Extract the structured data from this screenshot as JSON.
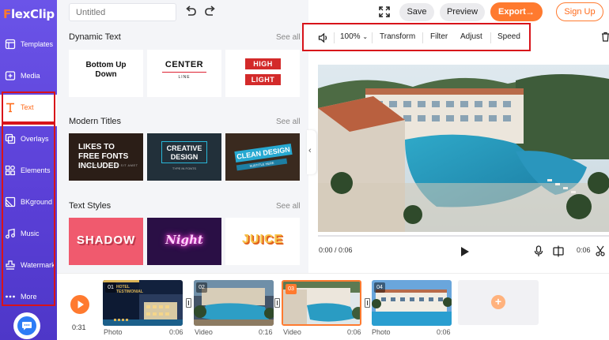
{
  "app": {
    "logo_mark": "F",
    "logo_rest": "lexClip",
    "title_placeholder": "Untitled"
  },
  "header": {
    "save_label": "Save",
    "preview_label": "Preview",
    "export_label": "Export",
    "export_arrow": "→",
    "signup_label": "Sign Up"
  },
  "sidebar": {
    "items": [
      {
        "label": "Templates",
        "icon": "templates-icon"
      },
      {
        "label": "Media",
        "icon": "media-icon"
      },
      {
        "label": "Text",
        "icon": "text-icon",
        "active": true
      },
      {
        "label": "Overlays",
        "icon": "overlays-icon"
      },
      {
        "label": "Elements",
        "icon": "elements-icon"
      },
      {
        "label": "BKground",
        "icon": "background-icon"
      },
      {
        "label": "Music",
        "icon": "music-icon"
      },
      {
        "label": "Watermark",
        "icon": "watermark-icon"
      },
      {
        "label": "More",
        "icon": "more-icon"
      }
    ]
  },
  "panel": {
    "see_all": "See all",
    "sections": [
      {
        "title": "Dynamic Text",
        "cards": {
          "c1": "Bottom Up Down",
          "c2_main": "CENTER",
          "c2_sub": "LINE",
          "c3_top": "HIGH",
          "c3_bottom": "LIGHT"
        }
      },
      {
        "title": "Modern Titles",
        "cards": {
          "c1": "LIKES TO FREE FONTS INCLUDED",
          "c1_sub": "LOREM IPSUM DOLOR SIT AMET",
          "c2": "CREATIVE DESIGN",
          "c2_sub": "TYPE IN FONTS",
          "c3": "CLEAN DESIGN",
          "c3_sub": "SUBTITLE HERE"
        }
      },
      {
        "title": "Text Styles",
        "cards": {
          "c1": "SHADOW",
          "c2": "Night",
          "c3": "JUICE"
        }
      }
    ]
  },
  "toolbar": {
    "zoom": "100%",
    "transform": "Transform",
    "filter": "Filter",
    "adjust": "Adjust",
    "speed": "Speed"
  },
  "player": {
    "time_current": "0:00 / 0:06",
    "time_clip": "0:06"
  },
  "timeline": {
    "total_duration": "0:31",
    "clips": [
      {
        "num": "01",
        "type": "Photo",
        "duration": "0:06",
        "thumb_text": "HOTEL TESTIMONIAL"
      },
      {
        "num": "02",
        "type": "Video",
        "duration": "0:16"
      },
      {
        "num": "03",
        "type": "Video",
        "duration": "0:06",
        "selected": true
      },
      {
        "num": "04",
        "type": "Photo",
        "duration": "0:06"
      }
    ],
    "add_label": "+"
  },
  "colors": {
    "brand_purple": "#5a3fd6",
    "accent_orange": "#ff7a2f",
    "highlight_red": "#d8131a"
  }
}
